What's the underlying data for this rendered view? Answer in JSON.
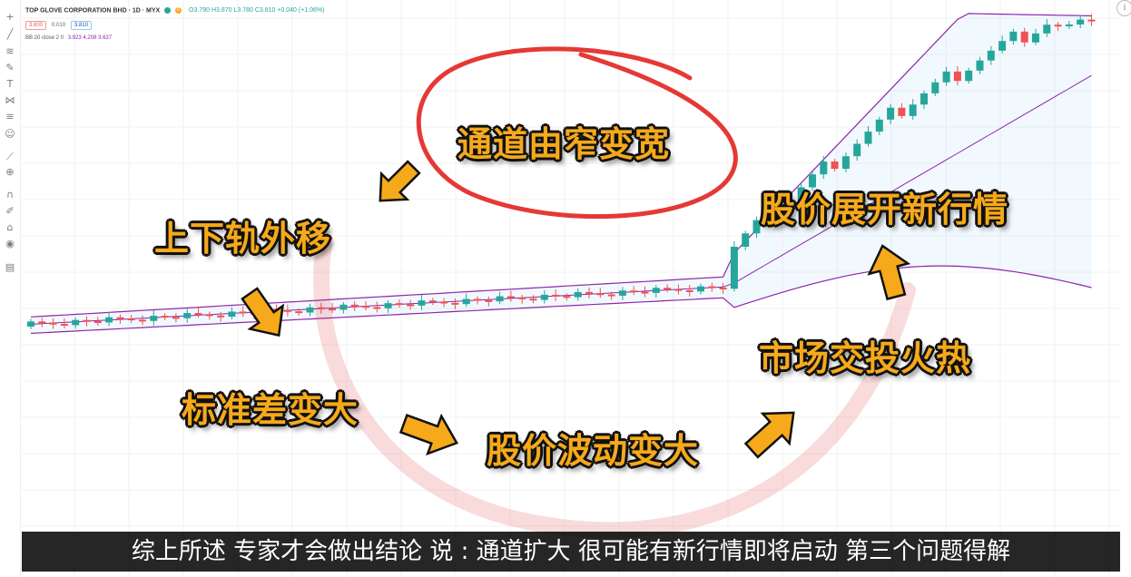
{
  "header": {
    "title": "TOP GLOVE CORPORATION BHD · 1D · MYX",
    "ohlc": "O3.790 H3.870 L3.780 C3.810 +0.040 (+1.06%)",
    "badge_d": "D"
  },
  "price_box": {
    "sell": "3.800",
    "spread": "0.010",
    "buy": "3.810"
  },
  "indicator": {
    "label": "BB 20 close 2 0",
    "values": "3.923  4.208  3.637"
  },
  "annotations": {
    "channel_widen": "通道由窄变宽",
    "bands_outward": "上下轨外移",
    "stdev_up": "标准差变大",
    "price_volatility_up": "股价波动变大",
    "market_hot": "市场交投火热",
    "new_trend": "股价展开新行情"
  },
  "subtitle": "综上所述 专家才会做出结论 说 : 通道扩大 很可能有新行情即将启动 第三个问题得解",
  "info_button": "i",
  "colors": {
    "up": "#26a69a",
    "down": "#ef5350",
    "band": "#8e24aa",
    "annotation": "#f6a91a",
    "circle": "#e53935"
  },
  "toolbar_icons": [
    "crosshair-icon",
    "trendline-icon",
    "fib-icon",
    "brush-icon",
    "text-icon",
    "pattern-icon",
    "forecast-icon",
    "emoji-icon",
    "ruler-icon",
    "zoom-icon",
    "magnet-icon",
    "lock-drawing-icon",
    "lock-icon",
    "eye-icon",
    "trash-icon"
  ]
}
